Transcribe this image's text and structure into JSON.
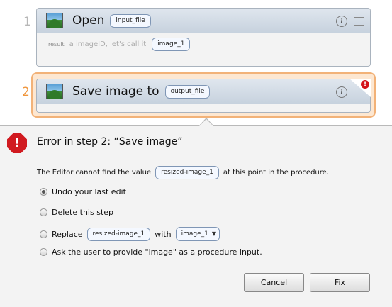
{
  "steps": [
    {
      "number": "1",
      "title": "Open",
      "param": "input_file",
      "result_label": "result",
      "result_text": "a imageID, let's call it",
      "result_var": "image_1"
    },
    {
      "number": "2",
      "title": "Save image to",
      "param": "output_file",
      "badge": "!"
    }
  ],
  "icons": {
    "info": "i",
    "error": "!"
  },
  "error": {
    "title": "Error in step 2: “Save image”",
    "desc_before": "The Editor cannot find the value",
    "desc_var": "resized-image_1",
    "desc_after": "at this point in the procedure.",
    "options": {
      "undo": "Undo your last edit",
      "delete": "Delete this step",
      "replace_label": "Replace",
      "replace_from": "resized-image_1",
      "replace_with_label": "with",
      "replace_to": "image_1",
      "ask": "Ask the user to provide \"image\" as a procedure input."
    },
    "selected_option": "undo"
  },
  "buttons": {
    "cancel": "Cancel",
    "fix": "Fix"
  },
  "colors": {
    "accent": "#f0963c",
    "error": "#d11a20",
    "header": "#c7d2de"
  }
}
